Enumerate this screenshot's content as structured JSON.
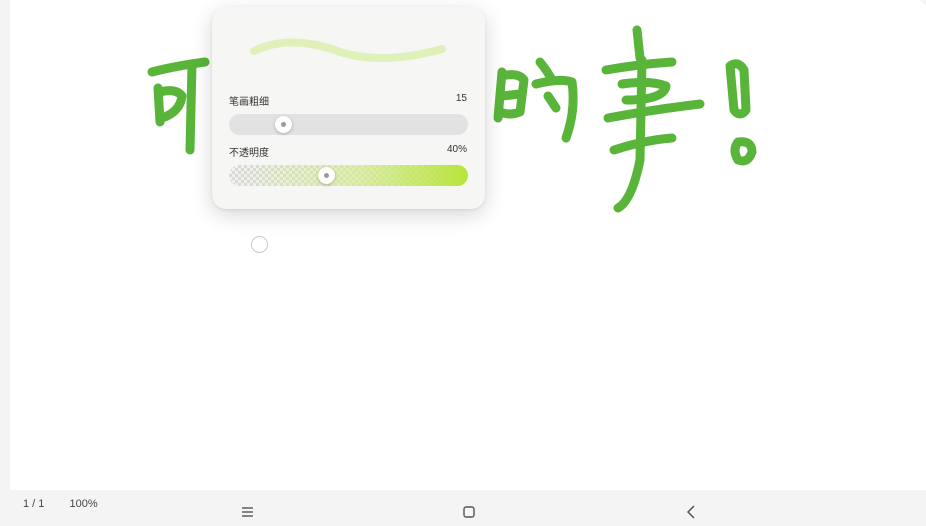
{
  "pen_settings": {
    "stroke_width_label": "笔画粗细",
    "stroke_width_value": "15",
    "stroke_width_level": 0.2,
    "opacity_label": "不透明度",
    "opacity_value": "40%",
    "opacity_level": 0.4,
    "pen_color": "#4caf2a",
    "preview_color": "#dff0b8"
  },
  "canvas_text": [
    "可",
    "的",
    "事",
    "!"
  ],
  "status": {
    "page": "1 / 1",
    "zoom": "100%"
  },
  "nav": {
    "menu_icon": "menu-icon",
    "home_icon": "home-icon",
    "back_icon": "back-icon"
  }
}
